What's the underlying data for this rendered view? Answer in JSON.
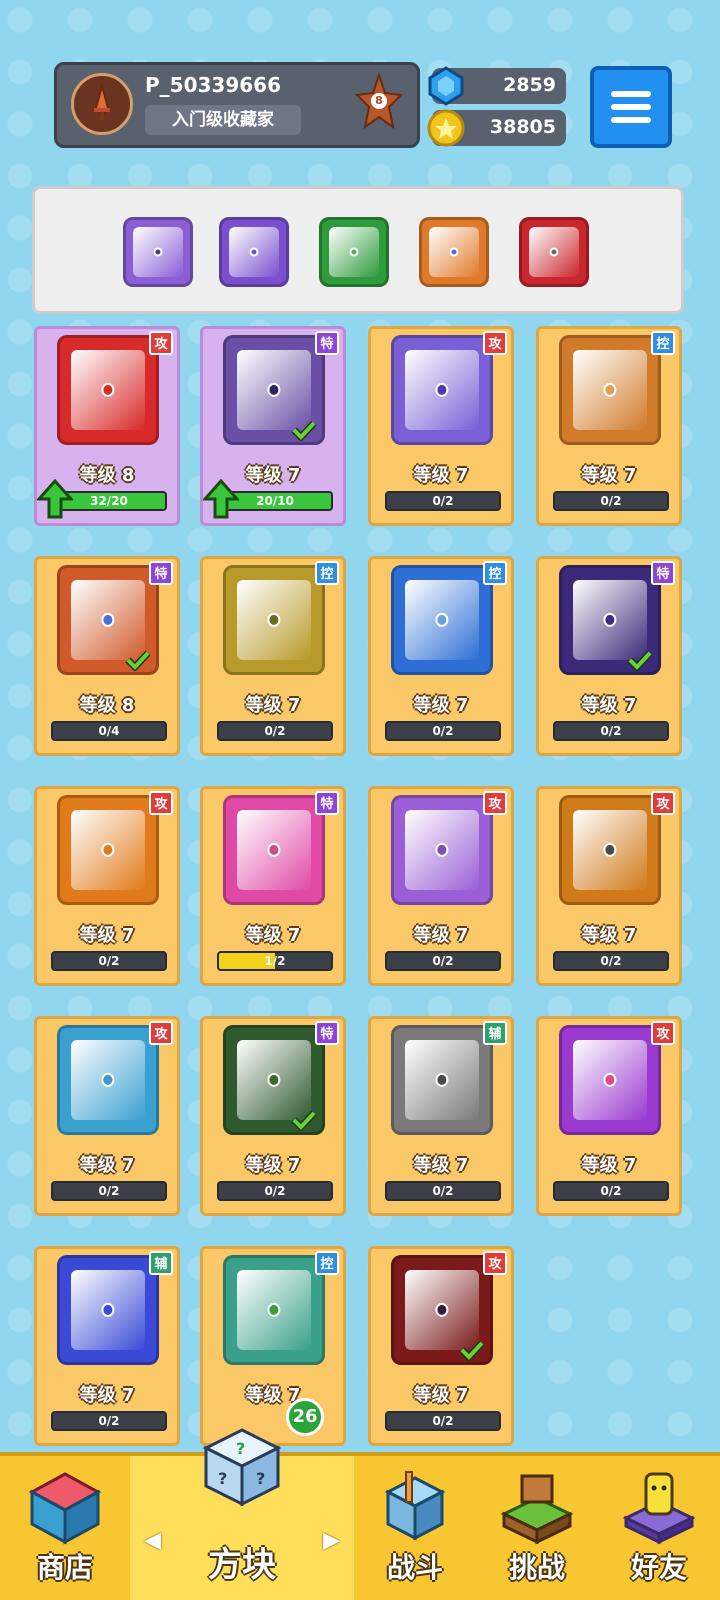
{
  "profile": {
    "player_name": "P_50339666",
    "title": "入门级收藏家",
    "rank_level": "8",
    "avatar_icon": "sword-icon"
  },
  "currency": {
    "gems": "2859",
    "coins": "38805"
  },
  "deck": [
    {
      "color": "#8a5fd6",
      "pip": "#4b3a8c"
    },
    {
      "color": "#7a4fcf",
      "pip": "#6a4fd6"
    },
    {
      "color": "#2e9b3c",
      "pip": "#4fb34b"
    },
    {
      "color": "#e07a2a",
      "pip": "#4a6fd6"
    },
    {
      "color": "#c9262e",
      "pip": "#6a6a6a"
    }
  ],
  "colors": {
    "attack": "#e03c3c",
    "special": "#8e44d6",
    "control": "#2e8fe0",
    "support": "#2ea06e",
    "progress_green": "#39c63c",
    "progress_yellow": "#f3d21a"
  },
  "cards": [
    {
      "level": "等级 8",
      "progress": "32/20",
      "fill": 1.0,
      "badge": "攻",
      "type": "attack",
      "color": "#d82a2a",
      "pip": "#d82a2a",
      "upgradable": true,
      "check": false
    },
    {
      "level": "等级 7",
      "progress": "20/10",
      "fill": 1.0,
      "badge": "特",
      "type": "special",
      "color": "#6a4fa6",
      "pip": "#2b2660",
      "upgradable": true,
      "check": true
    },
    {
      "level": "等级 7",
      "progress": "0/2",
      "fill": 0,
      "badge": "攻",
      "type": "attack",
      "color": "#7a5fd6",
      "pip": "#4b3aa8",
      "upgradable": false,
      "check": false
    },
    {
      "level": "等级 7",
      "progress": "0/2",
      "fill": 0,
      "badge": "控",
      "type": "control",
      "color": "#d07a2a",
      "pip": "#e0a050",
      "upgradable": false,
      "check": false
    },
    {
      "level": "等级 8",
      "progress": "0/4",
      "fill": 0,
      "badge": "特",
      "type": "special",
      "color": "#d05a2a",
      "pip": "#4a6fd6",
      "upgradable": false,
      "check": true
    },
    {
      "level": "等级 7",
      "progress": "0/2",
      "fill": 0,
      "badge": "控",
      "type": "control",
      "color": "#b89a2a",
      "pip": "#6b6b20",
      "upgradable": false,
      "check": false
    },
    {
      "level": "等级 7",
      "progress": "0/2",
      "fill": 0,
      "badge": "控",
      "type": "control",
      "color": "#2e6fd6",
      "pip": "#6aa0e0",
      "upgradable": false,
      "check": false
    },
    {
      "level": "等级 7",
      "progress": "0/2",
      "fill": 0,
      "badge": "特",
      "type": "special",
      "color": "#3b2a7a",
      "pip": "#3b2a8a",
      "upgradable": false,
      "check": true
    },
    {
      "level": "等级 7",
      "progress": "0/2",
      "fill": 0,
      "badge": "攻",
      "type": "attack",
      "color": "#e07a1a",
      "pip": "#e07a1a",
      "upgradable": false,
      "check": false
    },
    {
      "level": "等级 7",
      "progress": "1/2",
      "fill": 0.5,
      "badge": "特",
      "type": "special",
      "color": "#e04aa6",
      "pip": "#d04a8a",
      "upgradable": false,
      "check": false
    },
    {
      "level": "等级 7",
      "progress": "0/2",
      "fill": 0,
      "badge": "攻",
      "type": "attack",
      "color": "#9a5fd6",
      "pip": "#7a4fb6",
      "upgradable": false,
      "check": false
    },
    {
      "level": "等级 7",
      "progress": "0/2",
      "fill": 0,
      "badge": "攻",
      "type": "attack",
      "color": "#d07a1a",
      "pip": "#4a4a4a",
      "upgradable": false,
      "check": false
    },
    {
      "level": "等级 7",
      "progress": "0/2",
      "fill": 0,
      "badge": "攻",
      "type": "attack",
      "color": "#3aa0d0",
      "pip": "#3a9ad0",
      "upgradable": false,
      "check": false
    },
    {
      "level": "等级 7",
      "progress": "0/2",
      "fill": 0,
      "badge": "特",
      "type": "special",
      "color": "#2e5a2e",
      "pip": "#3a6a2e",
      "upgradable": false,
      "check": true
    },
    {
      "level": "等级 7",
      "progress": "0/2",
      "fill": 0,
      "badge": "辅",
      "type": "support",
      "color": "#7a7a7a",
      "pip": "#4a4a4a",
      "upgradable": false,
      "check": false
    },
    {
      "level": "等级 7",
      "progress": "0/2",
      "fill": 0,
      "badge": "攻",
      "type": "attack",
      "color": "#9a3ad0",
      "pip": "#e04a8a",
      "upgradable": false,
      "check": false
    },
    {
      "level": "等级 7",
      "progress": "0/2",
      "fill": 0,
      "badge": "辅",
      "type": "support",
      "color": "#3a4ad6",
      "pip": "#3a4ad6",
      "upgradable": false,
      "check": false
    },
    {
      "level": "等级 7",
      "progress": "",
      "fill": 0,
      "badge": "控",
      "type": "control",
      "color": "#3aa08a",
      "pip": "#3aa03a",
      "upgradable": false,
      "check": false
    },
    {
      "level": "等级 7",
      "progress": "0/2",
      "fill": 0,
      "badge": "攻",
      "type": "attack",
      "color": "#7a1a1a",
      "pip": "#3a1a3a",
      "upgradable": false,
      "check": true
    }
  ],
  "nav": {
    "shop": "商店",
    "dice": "方块",
    "battle": "战斗",
    "challenge": "挑战",
    "friends": "好友",
    "dice_notification": "26"
  }
}
